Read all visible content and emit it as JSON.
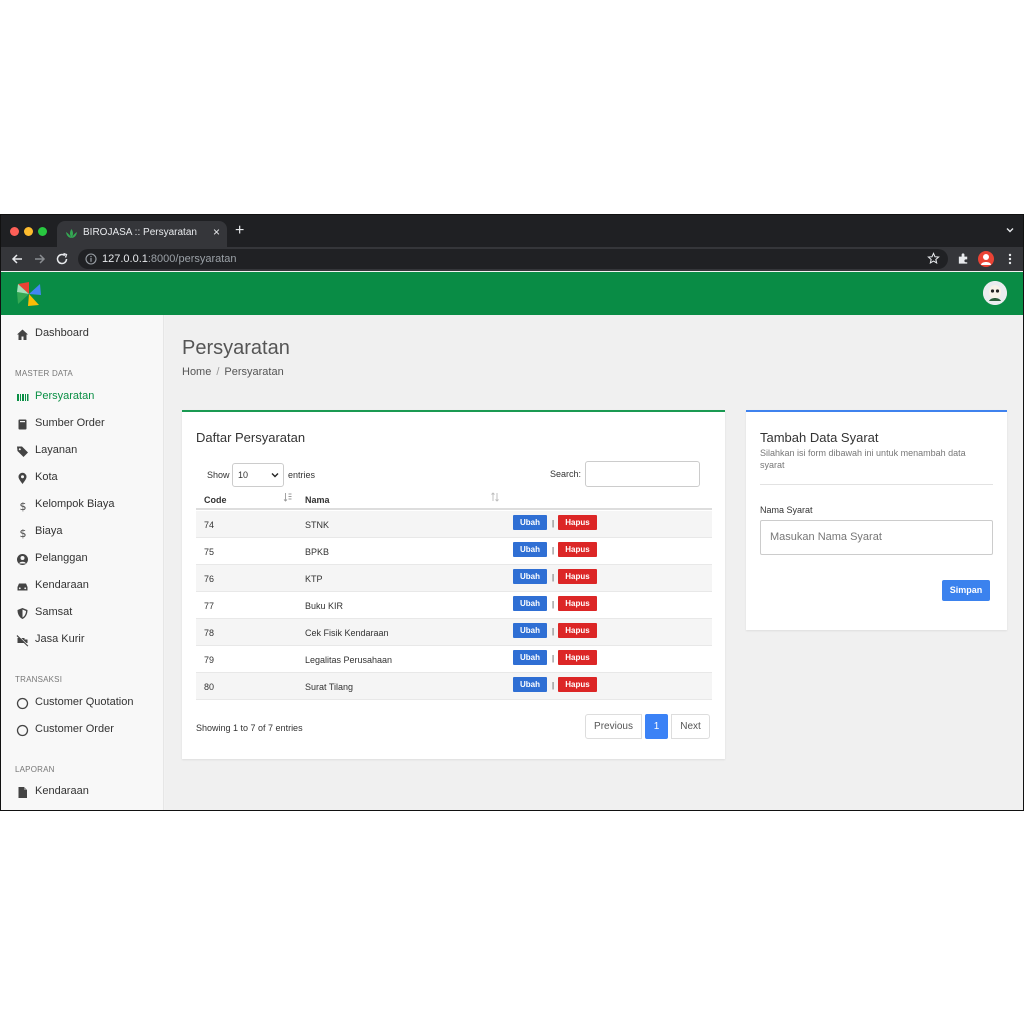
{
  "browser": {
    "tab_title": "BIROJASA :: Persyaratan",
    "tab_close": "×",
    "new_tab": "+",
    "url_host": "127.0.0.1",
    "url_rest": ":8000/persyaratan"
  },
  "sidebar": {
    "dashboard": "Dashboard",
    "master_head": "MASTER DATA",
    "master_items": [
      "Persyaratan",
      "Sumber Order",
      "Layanan",
      "Kota",
      "Kelompok Biaya",
      "Biaya",
      "Pelanggan",
      "Kendaraan",
      "Samsat",
      "Jasa Kurir"
    ],
    "transaksi_head": "TRANSAKSI",
    "transaksi_items": [
      "Customer Quotation",
      "Customer Order"
    ],
    "laporan_head": "LAPORAN",
    "laporan_items": [
      "Kendaraan"
    ]
  },
  "page": {
    "title": "Persyaratan",
    "breadcrumb_home": "Home",
    "breadcrumb_sep": "/",
    "breadcrumb_current": "Persyaratan"
  },
  "list": {
    "title": "Daftar Persyaratan",
    "show_label": "Show",
    "show_value": "10",
    "entries_label": "entries",
    "search_label": "Search:",
    "col_code": "Code",
    "col_nama": "Nama",
    "btn_ubah": "Ubah",
    "separator": "|",
    "btn_hapus": "Hapus",
    "rows": [
      {
        "code": "74",
        "nama": "STNK"
      },
      {
        "code": "75",
        "nama": "BPKB"
      },
      {
        "code": "76",
        "nama": "KTP"
      },
      {
        "code": "77",
        "nama": "Buku KIR"
      },
      {
        "code": "78",
        "nama": "Cek Fisik Kendaraan"
      },
      {
        "code": "79",
        "nama": "Legalitas Perusahaan"
      },
      {
        "code": "80",
        "nama": "Surat Tilang"
      }
    ],
    "showing": "Showing 1 to 7 of 7 entries",
    "prev": "Previous",
    "page": "1",
    "next": "Next"
  },
  "form": {
    "title": "Tambah Data Syarat",
    "description": "Silahkan isi form dibawah ini untuk menambah data syarat",
    "field_label": "Nama Syarat",
    "field_placeholder": "Masukan Nama Syarat",
    "submit": "Simpan"
  },
  "colors": {
    "brand_green": "#098c45",
    "active_text": "#0a8f45",
    "btn_blue": "#2f6fd4",
    "btn_red": "#dc2626"
  }
}
